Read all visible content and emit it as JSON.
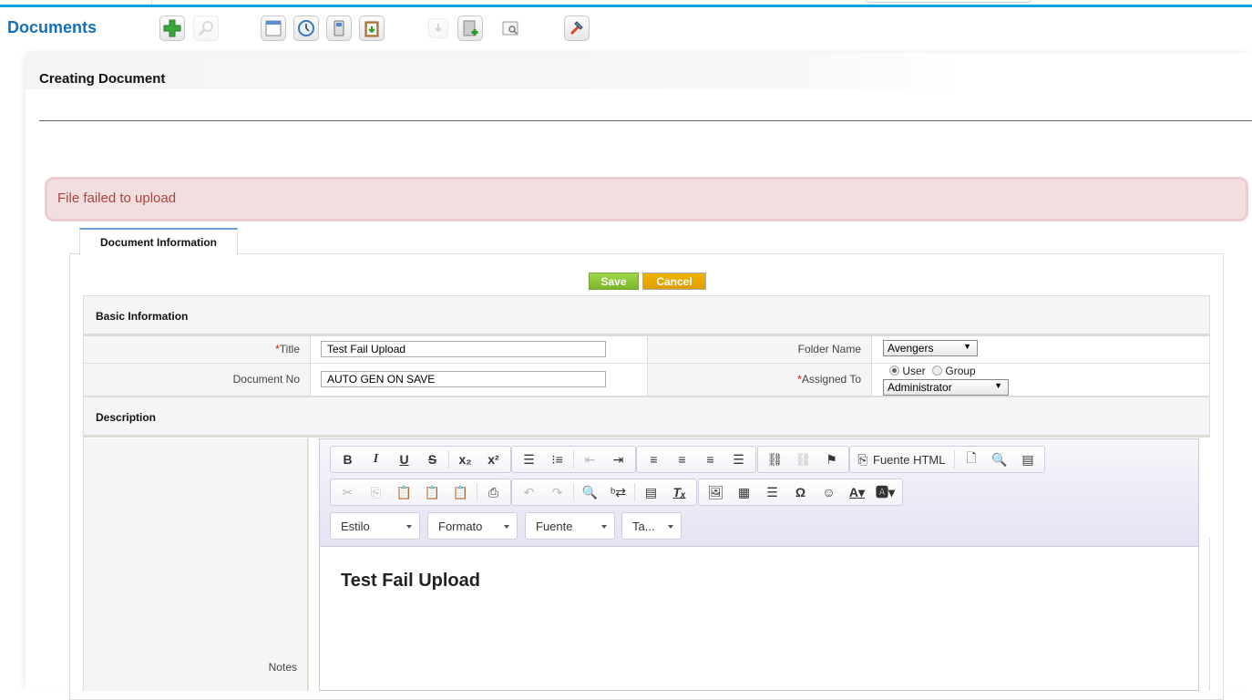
{
  "header": {
    "module_title": "Documents",
    "toolbar": [
      {
        "name": "create-icon",
        "label": "Create"
      },
      {
        "name": "search-icon",
        "label": "Search",
        "disabled": true
      },
      {
        "name": "calendar-icon",
        "label": "Calendar"
      },
      {
        "name": "clock-icon",
        "label": "Time"
      },
      {
        "name": "calculator-icon",
        "label": "Calculator"
      },
      {
        "name": "clipboard-import-icon",
        "label": "Import"
      },
      {
        "name": "export-icon",
        "label": "Export",
        "disabled": true
      },
      {
        "name": "add-document-icon",
        "label": "Add document"
      },
      {
        "name": "find-duplicates-icon",
        "label": "Find duplicates"
      },
      {
        "name": "settings-hammer-icon",
        "label": "Settings"
      }
    ]
  },
  "panel": {
    "title": "Creating Document",
    "alert": "File failed to upload",
    "tab": "Document Information",
    "buttons": {
      "save": "Save",
      "cancel": "Cancel"
    },
    "sections": {
      "basic": "Basic Information",
      "description": "Description"
    },
    "fields": {
      "title": {
        "required_mark": "*",
        "label": "Title",
        "value": "Test Fail Upload"
      },
      "document_no": {
        "label": "Document No",
        "value": "AUTO GEN ON SAVE"
      },
      "folder_name": {
        "label": "Folder Name",
        "value": "Avengers"
      },
      "assigned_to": {
        "required_mark": "*",
        "label": "Assigned To",
        "radio_user": "User",
        "radio_group": "Group",
        "selected_radio": "User",
        "value": "Administrator"
      },
      "notes": {
        "label": "Notes"
      }
    }
  },
  "editor": {
    "row1": {
      "basic": [
        "B",
        "I",
        "U",
        "S",
        "x₂",
        "x²"
      ],
      "source_label": "Fuente HTML"
    },
    "combos": [
      "Estilo",
      "Formato",
      "Fuente",
      "Ta..."
    ],
    "content": "Test Fail Upload"
  },
  "colors": {
    "accent": "#08a3dc",
    "module_title": "#1470b8",
    "alert_bg": "#f2dede",
    "alert_text": "#a94442",
    "save": "#8cc63f",
    "cancel": "#e8a800"
  }
}
